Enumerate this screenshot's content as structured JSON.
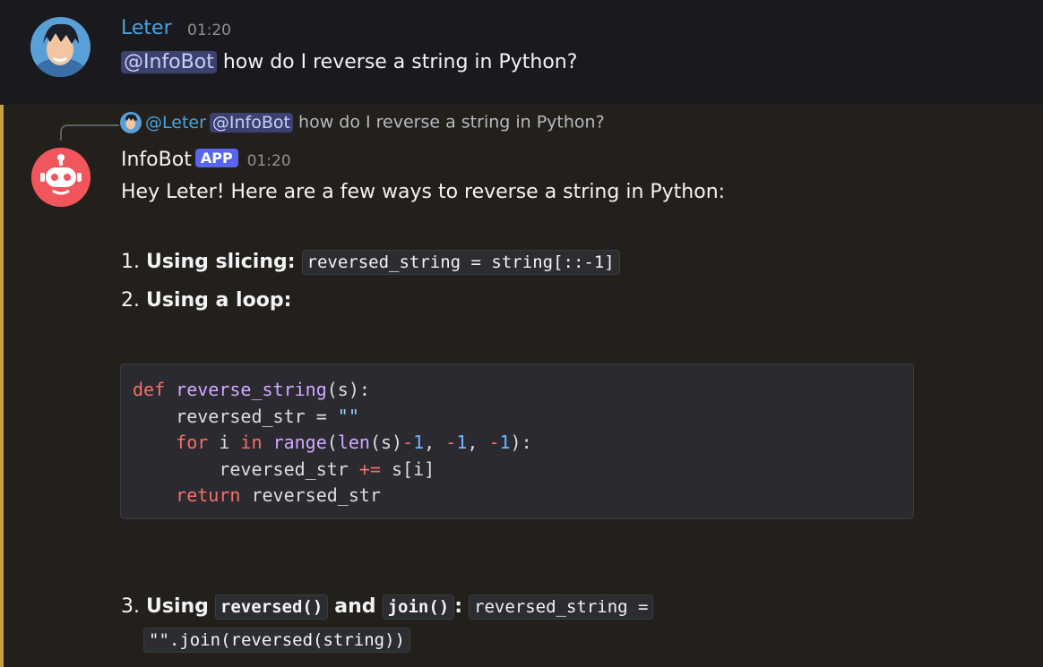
{
  "message1": {
    "author": "Leter",
    "time": "01:20",
    "mention": "@InfoBot",
    "text": "how do I reverse a string in Python?"
  },
  "message2": {
    "reply": {
      "author": "@Leter",
      "mention": "@InfoBot",
      "text": "how do I reverse a string in Python?"
    },
    "author": "InfoBot",
    "badge": "APP",
    "time": "01:20",
    "intro": "Hey Leter! Here are a few ways to reverse a string in Python:",
    "item1_prefix": "1. ",
    "item1_label": "Using slicing:",
    "item1_code": "reversed_string = string[::-1]",
    "item2_prefix": "2. ",
    "item2_label": "Using a loop:",
    "item3_prefix": "3. ",
    "item3_using": "Using",
    "item3_code_a": "reversed()",
    "item3_and": "and",
    "item3_code_b": "join()",
    "item3_colon": ":",
    "item3_code_line1": "reversed_string =",
    "item3_code_line2": "\"\".join(reversed(string))",
    "code_lines": [
      "def reverse_string(s):",
      "    reversed_str = \"\"",
      "    for i in range(len(s)-1, -1, -1):",
      "        reversed_str += s[i]",
      "    return reversed_str"
    ]
  },
  "colors": {
    "mention_bg": "#3c4270",
    "highlight_bar": "#c8a04a",
    "bot_avatar": "#f0565b",
    "app_badge": "#5865f2"
  },
  "icons": [
    "user-avatar",
    "bot-avatar-icon"
  ]
}
